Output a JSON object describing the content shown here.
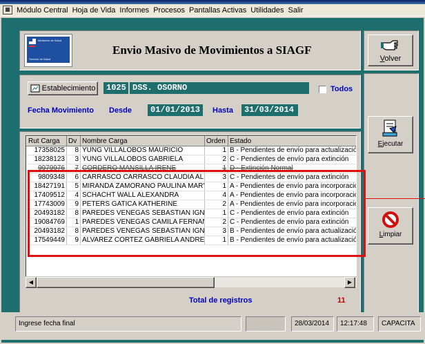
{
  "menu": {
    "items": [
      "Módulo Central",
      "Hoja de Vida",
      "Informes",
      "Procesos",
      "Pantallas Activas",
      "Utilidades",
      "Salir"
    ]
  },
  "header": {
    "title": "Envio Masivo de Movimientos a SIAGF",
    "logo_lines": [
      "Ministerio de Salud",
      "",
      "Servicio de Salud"
    ]
  },
  "buttons": {
    "volver": "Volver",
    "ejecutar": "Ejecutar",
    "limpiar": "Limpiar",
    "establecimiento": "Establecimiento"
  },
  "filters": {
    "establecimiento_code": "1025",
    "establecimiento_name": "DSS. OSORNO",
    "todos_label": "Todos",
    "todos_checked": false,
    "fecha_label": "Fecha Movimiento",
    "desde_label": "Desde",
    "desde_value": "01/01/2013",
    "hasta_label": "Hasta",
    "hasta_value": "31/03/2014"
  },
  "grid": {
    "columns": [
      "Rut Carga",
      "Dv",
      "Nombre Carga",
      "Orden",
      "Estado"
    ],
    "rows": [
      {
        "rut": "17358025",
        "dv": "8",
        "nombre": "YUNG VILLALOBOS MAURICIO",
        "orden": "1",
        "estado": "B - Pendientes de envío para actualizació",
        "struck": false
      },
      {
        "rut": "18238123",
        "dv": "3",
        "nombre": "YUNG VILLALOBOS GABRIELA",
        "orden": "2",
        "estado": "C - Pendientes de envío para extinción",
        "struck": false
      },
      {
        "rut": "9979976",
        "dv": "7",
        "nombre": "CORDERO MANSILLA IRENE",
        "orden": "1",
        "estado": "D - Extinción Normal",
        "struck": true
      },
      {
        "rut": "9809348",
        "dv": "6",
        "nombre": "CARRASCO CARRASCO CLAUDIA ALIC",
        "orden": "3",
        "estado": "C - Pendientes de envío para extinción",
        "struck": false
      },
      {
        "rut": "18427191",
        "dv": "5",
        "nombre": "MIRANDA ZAMORANO PAULINA MAR'",
        "orden": "1",
        "estado": "A - Pendientes de envío para incorporació",
        "struck": false
      },
      {
        "rut": "17409512",
        "dv": "4",
        "nombre": "SCHACHT WALL ALEXANDRA",
        "orden": "4",
        "estado": "A - Pendientes de envío para incorporació",
        "struck": false
      },
      {
        "rut": "17743009",
        "dv": "9",
        "nombre": "PETERS GATICA KATHERINE",
        "orden": "2",
        "estado": "A - Pendientes de envío para incorporació",
        "struck": false
      },
      {
        "rut": "20493182",
        "dv": "8",
        "nombre": "PAREDES VENEGAS SEBASTIAN IGNA",
        "orden": "1",
        "estado": "C - Pendientes de envío para extinción",
        "struck": false
      },
      {
        "rut": "19084769",
        "dv": "1",
        "nombre": "PAREDES VENEGAS CAMILA FERNAN",
        "orden": "2",
        "estado": "C - Pendientes de envío para extinción",
        "struck": false
      },
      {
        "rut": "20493182",
        "dv": "8",
        "nombre": "PAREDES VENEGAS SEBASTIAN IGN/",
        "orden": "3",
        "estado": "B - Pendientes de envío para actualizació",
        "struck": false
      },
      {
        "rut": "17549449",
        "dv": "9",
        "nombre": "ALVAREZ CORTEZ GABRIELA ANDRE.",
        "orden": "1",
        "estado": "B - Pendientes de envío para actualizació",
        "struck": false
      }
    ],
    "total_label": "Total de registros",
    "total_value": "11"
  },
  "status": {
    "message": "Ingrese fecha final",
    "empty": "",
    "date": "28/03/2014",
    "time": "12:17:48",
    "mode": "CAPACITA"
  },
  "colors": {
    "teal": "#1e6e6e",
    "highlight": "#e01010",
    "title_blue": "#0a246a",
    "label_blue": "#0000c0",
    "total_red": "#c00000"
  },
  "icons": [
    "app-icon",
    "hand-icon",
    "execute-document-icon",
    "no-entry-icon",
    "establishment-icon"
  ]
}
